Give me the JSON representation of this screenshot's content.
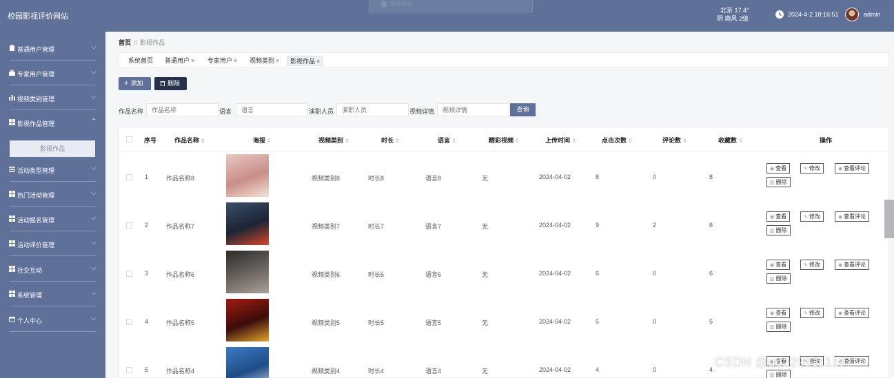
{
  "app_title": "校园影视评价网站",
  "toast": {
    "text": "删除成功"
  },
  "weather": {
    "line1": "北京 17.4°",
    "line2": "阴 南风 2级"
  },
  "datetime": "2024-4-2 18:16:51",
  "username": "admin",
  "sidebar": {
    "items": [
      {
        "label": "普通用户管理",
        "icon": "clipboard-icon"
      },
      {
        "label": "专家用户管理",
        "icon": "briefcase-icon"
      },
      {
        "label": "视频类别管理",
        "icon": "bar-chart-icon"
      },
      {
        "label": "影视作品管理",
        "icon": "grid-icon"
      },
      {
        "label": "活动类型管理",
        "icon": "list-icon"
      },
      {
        "label": "热门活动管理",
        "icon": "grid-icon"
      },
      {
        "label": "活动报名管理",
        "icon": "grid-icon"
      },
      {
        "label": "活动评价管理",
        "icon": "grid-icon"
      },
      {
        "label": "社交互动",
        "icon": "grid-icon"
      },
      {
        "label": "系统管理",
        "icon": "grid-icon"
      },
      {
        "label": "个人中心",
        "icon": "calendar-icon"
      }
    ],
    "submenu_active": "影视作品"
  },
  "breadcrumb": {
    "home": "首页",
    "separator": "//",
    "current": "影视作品"
  },
  "tabs": [
    {
      "label": "系统首页",
      "closable": false
    },
    {
      "label": "普通用户",
      "closable": true
    },
    {
      "label": "专家用户",
      "closable": true
    },
    {
      "label": "视频类别",
      "closable": true
    },
    {
      "label": "影视作品",
      "closable": true
    }
  ],
  "tab_close_glyph": "×",
  "actions": {
    "add": "添加",
    "delete": "删除"
  },
  "search": {
    "fields": [
      {
        "label": "作品名称",
        "placeholder": "作品名称"
      },
      {
        "label": "语言",
        "placeholder": "语言"
      },
      {
        "label": "演职人员",
        "placeholder": "演职人员"
      },
      {
        "label": "视频详情",
        "placeholder": "视频详情"
      }
    ],
    "query": "查询"
  },
  "table": {
    "headers": [
      "序号",
      "作品名称",
      "海报",
      "视频类别",
      "时长",
      "语言",
      "精彩视频",
      "上传时间",
      "点击次数",
      "评论数",
      "收藏数",
      "操作"
    ],
    "sort_glyph": "⇕",
    "rows": [
      {
        "no": "1",
        "name": "作品名称8",
        "category": "视频类别8",
        "duration": "时长8",
        "language": "语言8",
        "video": "无",
        "upload": "2024-04-02",
        "clicks": "8",
        "comments": "0",
        "favorites": "8",
        "poster": [
          "#e8c7c2",
          "#c98e88",
          "#f3e2d6"
        ]
      },
      {
        "no": "2",
        "name": "作品名称7",
        "category": "视频类别7",
        "duration": "时长7",
        "language": "语言7",
        "video": "无",
        "upload": "2024-04-02",
        "clicks": "9",
        "comments": "2",
        "favorites": "8",
        "poster": [
          "#3a4f6a",
          "#1c2433",
          "#d8472b"
        ]
      },
      {
        "no": "3",
        "name": "作品名称6",
        "category": "视频类别6",
        "duration": "时长6",
        "language": "语言6",
        "video": "无",
        "upload": "2024-04-02",
        "clicks": "6",
        "comments": "0",
        "favorites": "6",
        "poster": [
          "#2c2a28",
          "#6e6762",
          "#a8a29a"
        ]
      },
      {
        "no": "4",
        "name": "作品名称5",
        "category": "视频类别5",
        "duration": "时长5",
        "language": "语言5",
        "video": "无",
        "upload": "2024-04-02",
        "clicks": "5",
        "comments": "0",
        "favorites": "5",
        "poster": [
          "#a31a12",
          "#3a0d0a",
          "#e5a42b"
        ]
      },
      {
        "no": "5",
        "name": "作品名称4",
        "category": "视频类别4",
        "duration": "时长4",
        "language": "语言4",
        "video": "无",
        "upload": "2024-04-02",
        "clicks": "4",
        "comments": "0",
        "favorites": "4",
        "poster": [
          "#3b7cc4",
          "#1f4c86",
          "#c6d9ec"
        ]
      }
    ],
    "ops": {
      "view": "查看",
      "edit": "修改",
      "view_comments": "查看评论",
      "delete": "删除"
    }
  },
  "watermark": "CSDN @qq2293311197"
}
